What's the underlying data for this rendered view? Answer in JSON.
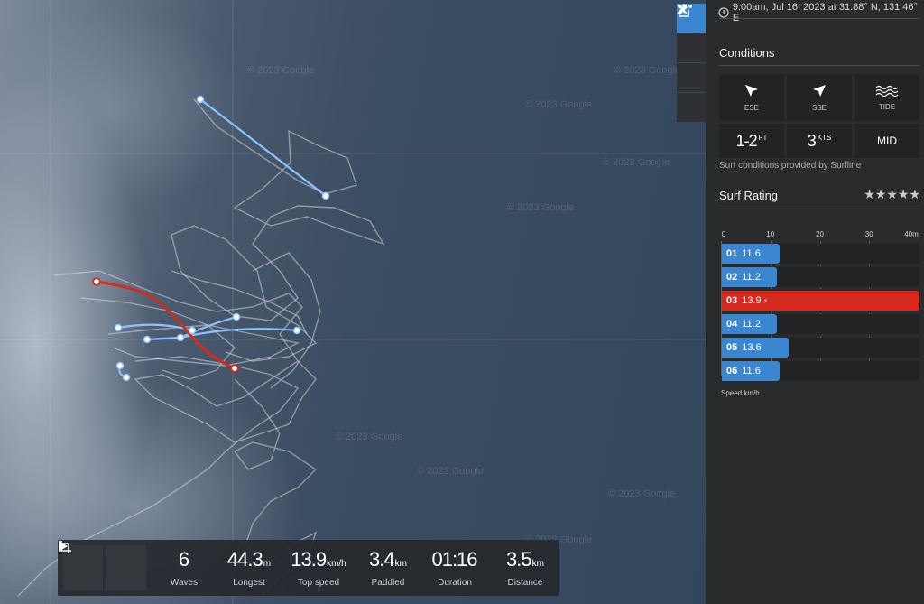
{
  "session": {
    "info": "9:00am, Jul 16, 2023 at 31.88° N, 131.46° E"
  },
  "map": {
    "watermark": "© 2023 Google",
    "tools": [
      {
        "name": "more-options-button",
        "icon": "more-dots-icon"
      },
      {
        "name": "edit-button",
        "icon": "pencil-icon"
      },
      {
        "name": "share-button",
        "icon": "share-icon"
      },
      {
        "name": "close-button",
        "icon": "close-icon"
      }
    ]
  },
  "stats": {
    "waves": {
      "value": "6",
      "unit": "",
      "label": "Waves"
    },
    "longest": {
      "value": "44.3",
      "unit": "m",
      "label": "Longest"
    },
    "top_speed": {
      "value": "13.9",
      "unit": "km/h",
      "label": "Top speed"
    },
    "paddled": {
      "value": "3.4",
      "unit": "km",
      "label": "Paddled"
    },
    "duration": {
      "value": "01:16",
      "unit": "",
      "label": "Duration"
    },
    "distance": {
      "value": "3.5",
      "unit": "km",
      "label": "Distance"
    }
  },
  "conditions": {
    "title": "Conditions",
    "swell_direction": "ESE",
    "wind_direction": "SSE",
    "tide_label": "TIDE",
    "wave_height": "1-2",
    "wave_height_unit": "FT",
    "wind_speed": "3",
    "wind_speed_unit": "KTS",
    "tide_value": "MID",
    "provider_note": "Surf conditions provided by Surfline"
  },
  "surf_rating": {
    "title": "Surf Rating",
    "stars": "★★★★★"
  },
  "chart_data": {
    "type": "bar",
    "orientation": "horizontal",
    "categories": [
      "01",
      "02",
      "03",
      "04",
      "05",
      "06"
    ],
    "values": [
      11.6,
      11.2,
      13.9,
      11.2,
      13.6,
      11.6
    ],
    "labels": [
      "11.6",
      "11.2",
      "13.9",
      "11.2",
      "13.6",
      "11.6"
    ],
    "highlight_index": 2,
    "xlim": [
      0,
      40
    ],
    "ticks": [
      "0",
      "10",
      "20",
      "30",
      "40m"
    ],
    "xlabel": "Speed km/h",
    "colors": {
      "bar": "#3a86d0",
      "best": "#d62a1e"
    }
  }
}
